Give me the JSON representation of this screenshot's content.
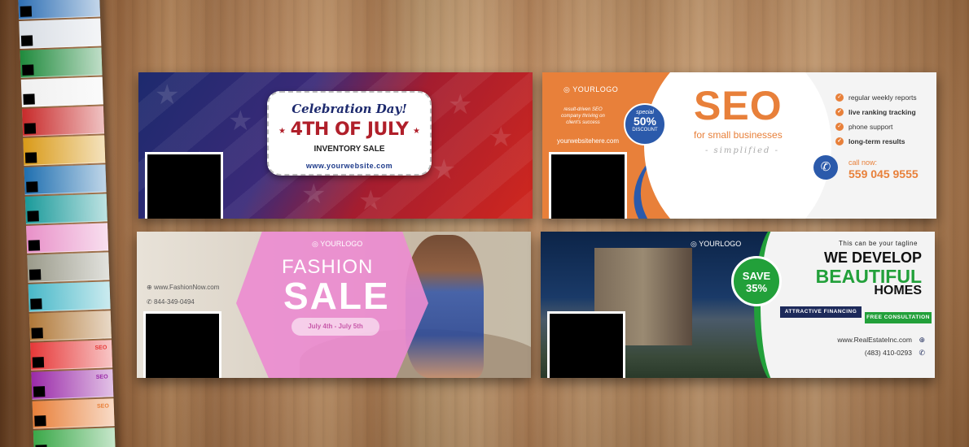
{
  "strip": {
    "items": [
      {
        "color": "#2e6fb4",
        "text": ""
      },
      {
        "color": "#d8dde4",
        "text": ""
      },
      {
        "color": "#1f8a3c",
        "text": ""
      },
      {
        "color": "#f0f0f0",
        "text": ""
      },
      {
        "color": "#c82a2a",
        "text": ""
      },
      {
        "color": "#d99a18",
        "text": ""
      },
      {
        "color": "#1f6fb0",
        "text": ""
      },
      {
        "color": "#1a9a9a",
        "text": ""
      },
      {
        "color": "#e890c8",
        "text": ""
      },
      {
        "color": "#9a9a8a",
        "text": ""
      },
      {
        "color": "#48b8c8",
        "text": ""
      },
      {
        "color": "#b07838",
        "text": ""
      },
      {
        "color": "#e63838",
        "text": "SEO"
      },
      {
        "color": "#9a2aa8",
        "text": "SEO"
      },
      {
        "color": "#e8803a",
        "text": "SEO"
      },
      {
        "color": "#3aa848",
        "text": ""
      }
    ]
  },
  "july": {
    "script": "Celebration Day!",
    "title": "4TH OF JULY",
    "subtitle": "INVENTORY SALE",
    "website": "www.yourwebsite.com"
  },
  "seo": {
    "logo": "YOURLOGO",
    "tagline": "result-driven SEO company thriving on client's success",
    "website": "yourwebsitehere.com",
    "badge_top": "special",
    "badge_pct": "50%",
    "badge_bottom": "DISCOUNT",
    "title": "SEO",
    "subtitle": "for small businesses",
    "simplified": "- simplified -",
    "features": [
      "regular weekly reports",
      "live ranking tracking",
      "phone support",
      "long-term results"
    ],
    "call_label": "call now:",
    "phone": "559 045 9555"
  },
  "fashion": {
    "logo": "YOURLOGO",
    "title": "FASHION",
    "sale": "SALE",
    "dates": "July 4th - July 5th",
    "website": "www.FashionNow.com",
    "phone": "844-349-0494"
  },
  "realestate": {
    "logo": "YOURLOGO",
    "badge_top": "SAVE",
    "badge_pct": "35%",
    "tagline": "This can be your tagline",
    "line1": "WE DEVELOP",
    "line2": "BEAUTIFUL",
    "line3": "HOMES",
    "financing": "ATTRACTIVE FINANCING",
    "consultation": "FREE CONSULTATION",
    "website": "www.RealEstateInc.com",
    "phone": "(483) 410-0293"
  }
}
